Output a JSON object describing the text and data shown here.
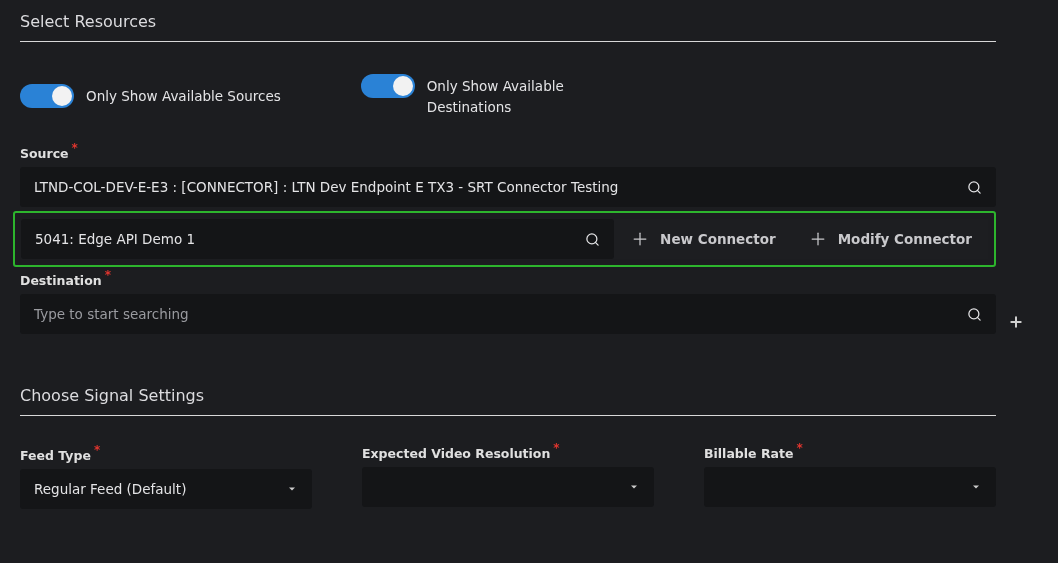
{
  "resources": {
    "title": "Select Resources",
    "toggles": [
      {
        "label": "Only Show Available Sources",
        "on": true
      },
      {
        "label": "Only Show Available Destinations",
        "on": true
      }
    ],
    "source": {
      "label": "Source",
      "mark": "*",
      "value": "LTND-COL-DEV-E-E3 : [CONNECTOR] : LTN Dev Endpoint E TX3 - SRT Connector Testing"
    },
    "connector": {
      "value": "5041: Edge API Demo 1",
      "highlighted": true,
      "buttons": [
        "New Connector",
        "Modify Connector"
      ]
    },
    "destination": {
      "label": "Destination",
      "mark": "*",
      "placeholder": "Type to start searching"
    }
  },
  "signal": {
    "title": "Choose Signal Settings",
    "fields": [
      {
        "label": "Feed Type",
        "mark": "*",
        "value": "Regular Feed (Default)"
      },
      {
        "label": "Expected Video Resolution",
        "mark": "*"
      },
      {
        "label": "Billable Rate",
        "mark": "*"
      }
    ]
  }
}
